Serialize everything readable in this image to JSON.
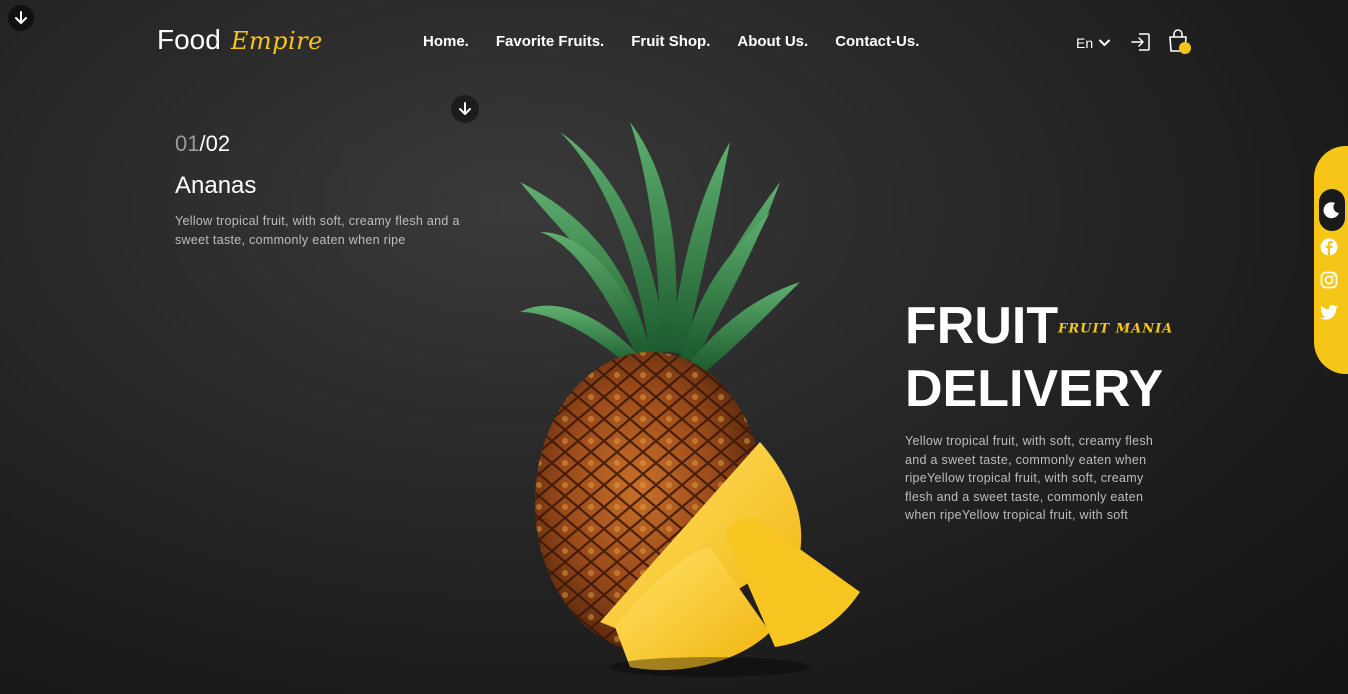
{
  "brand": {
    "name": "Food",
    "script": "Empire"
  },
  "nav": [
    {
      "label": "Home."
    },
    {
      "label": "Favorite Fruits."
    },
    {
      "label": "Fruit Shop."
    },
    {
      "label": "About Us."
    },
    {
      "label": "Contact-Us."
    }
  ],
  "header": {
    "language": "En"
  },
  "slider": {
    "current": "01",
    "total": "02",
    "title": "Ananas",
    "description": "Yellow tropical fruit, with soft, creamy flesh and a sweet taste, commonly eaten when ripe"
  },
  "hero": {
    "title_line1": "FRUIT",
    "tagline": "FRUIT MANIA",
    "title_line2": "DELIVERY",
    "description": "Yellow tropical fruit, with soft, creamy flesh and a sweet taste, commonly eaten when ripeYellow tropical fruit, with soft, creamy flesh and a sweet taste, commonly eaten when ripeYellow tropical fruit, with soft"
  },
  "colors": {
    "accent": "#f5c518",
    "background": "#1e1e1e"
  },
  "icons": [
    "arrow-down-icon",
    "chevron-down-icon",
    "login-icon",
    "shopping-bag-icon",
    "moon-icon",
    "facebook-icon",
    "instagram-icon",
    "twitter-icon"
  ]
}
